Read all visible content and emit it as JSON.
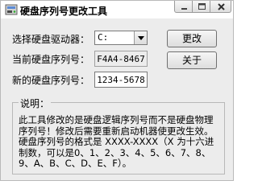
{
  "window": {
    "title": "硬盘序列号更改工具",
    "app_icon": "app-icon",
    "title_buttons": [
      "minimize-icon",
      "maximize-icon",
      "close-icon"
    ]
  },
  "form": {
    "drive_label": "选择硬盘驱动器：",
    "drive_value": "C:",
    "current_serial_label": "当前硬盘序列号：",
    "current_serial_value": "F4A4-8467",
    "new_serial_label": "新的硬盘序列号：",
    "new_serial_value": "1234-5678"
  },
  "buttons": {
    "change_label": "更改",
    "about_label": "关于"
  },
  "note": {
    "title": "说明：",
    "text": "此工具修改的是硬盘逻辑序列号而不是硬盘物理序列号！修改后需要重新启动机器使更改生效。硬盘序列号的格式是 XXXX-XXXX（X 为十六进制数，可以是0、1、2、3、4、5、6、7、8、9、A、B、C、D、E、F）。"
  },
  "colors": {
    "window_bg": "#ececec",
    "titlebar_bg": "#ffffff",
    "close_glyph": "#000000"
  }
}
